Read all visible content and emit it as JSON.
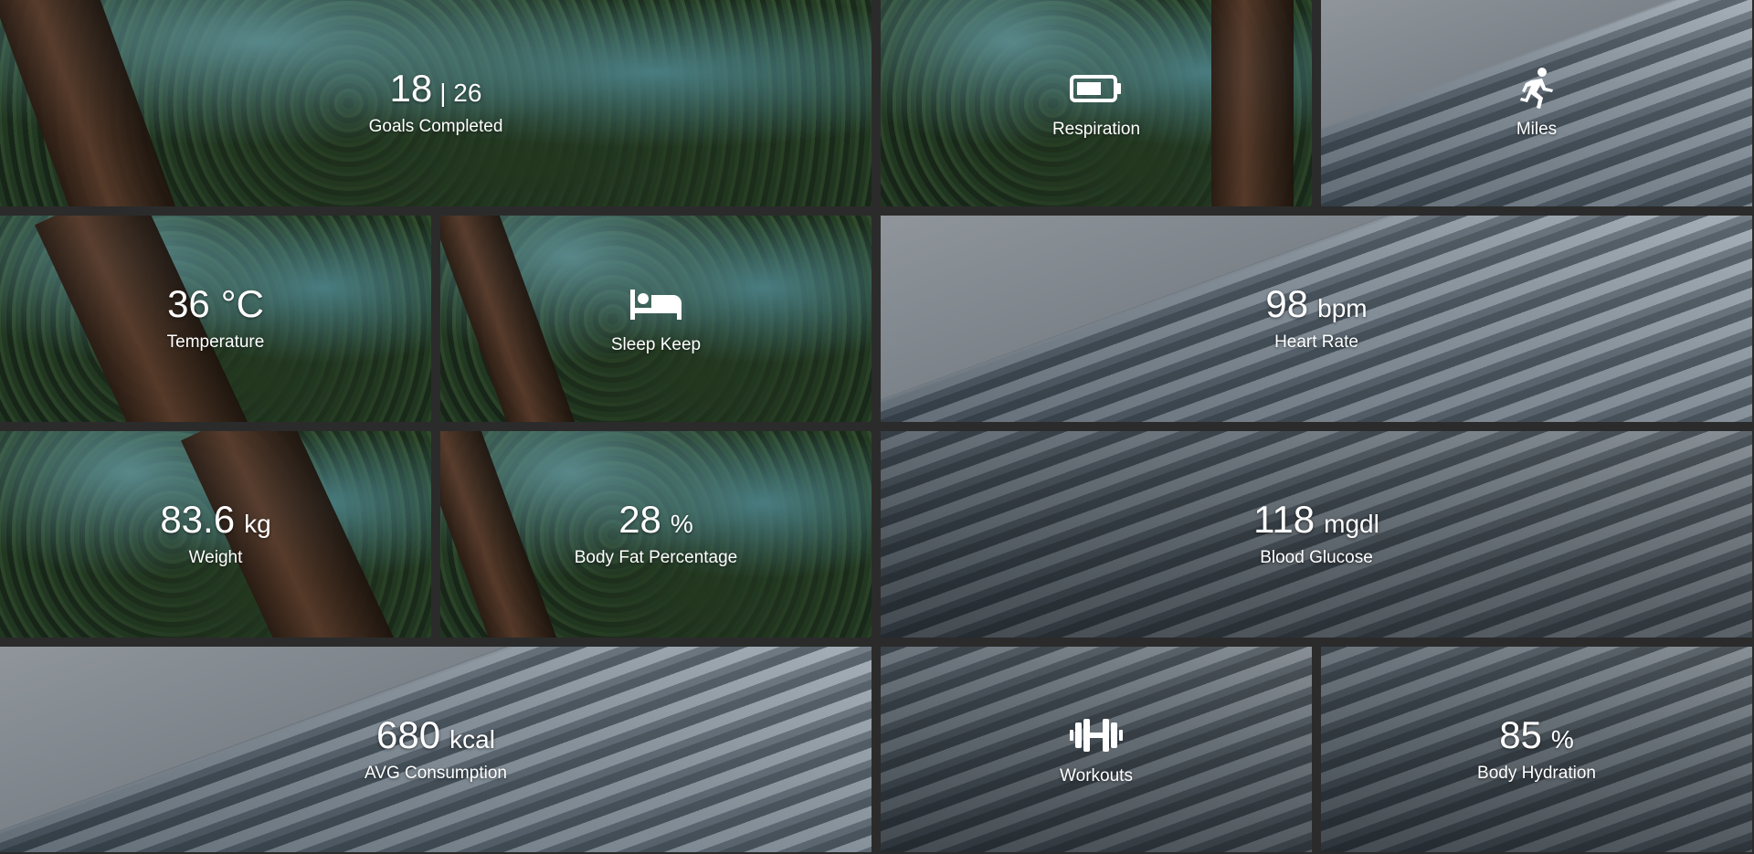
{
  "tiles": {
    "goals": {
      "value": "18",
      "secondary": "| 26",
      "label": "Goals Completed"
    },
    "respiration": {
      "icon": "battery-icon",
      "label": "Respiration"
    },
    "miles": {
      "icon": "running-person-icon",
      "label": "Miles"
    },
    "temperature": {
      "value": "36",
      "unit": "°C",
      "label": "Temperature"
    },
    "sleep": {
      "icon": "bed-icon",
      "label": "Sleep Keep"
    },
    "heart_rate": {
      "value": "98",
      "unit": "bpm",
      "label": "Heart Rate"
    },
    "weight": {
      "value": "83.6",
      "unit": "kg",
      "label": "Weight"
    },
    "body_fat": {
      "value": "28",
      "unit": "%",
      "label": "Body Fat Percentage"
    },
    "blood_glucose": {
      "value": "118",
      "unit": "mgdl",
      "label": "Blood Glucose"
    },
    "consumption": {
      "value": "680",
      "unit": "kcal",
      "label": "AVG Consumption"
    },
    "workouts": {
      "icon": "dumbbell-icon",
      "label": "Workouts"
    },
    "hydration": {
      "value": "85",
      "unit": "%",
      "label": "Body Hydration"
    }
  },
  "colors": {
    "gutter": "#2b2b2b",
    "text": "#ffffff"
  }
}
